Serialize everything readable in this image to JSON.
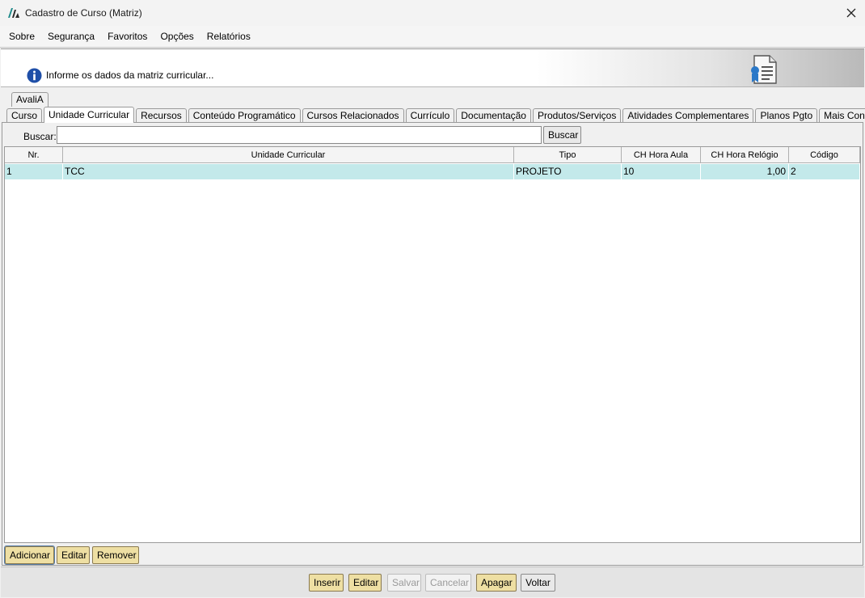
{
  "window": {
    "title": "Cadastro de Curso (Matriz)"
  },
  "menu": [
    {
      "label": "Sobre"
    },
    {
      "label": "Segurança"
    },
    {
      "label": "Favoritos"
    },
    {
      "label": "Opções"
    },
    {
      "label": "Relatórios"
    }
  ],
  "banner": {
    "message": "Informe os dados da matriz curricular..."
  },
  "tabs_top": [
    "AvaliA"
  ],
  "tabs": [
    "Curso",
    "Unidade Curricular",
    "Recursos",
    "Conteúdo Programático",
    "Cursos Relacionados",
    "Currículo",
    "Documentação",
    "Produtos/Serviços",
    "Atividades Complementares",
    "Planos Pgto",
    "Mais Configs."
  ],
  "active_tab": "Unidade Curricular",
  "search": {
    "label": "Buscar:",
    "value": "",
    "button": "Buscar"
  },
  "table": {
    "columns": [
      "Nr.",
      "Unidade Curricular",
      "Tipo",
      "CH Hora Aula",
      "CH Hora Relógio",
      "Código"
    ],
    "rows": [
      [
        "1",
        "TCC",
        "PROJETO",
        "10",
        "1,00",
        "2"
      ]
    ]
  },
  "panel_buttons": {
    "add": "Adicionar",
    "edit": "Editar",
    "remove": "Remover"
  },
  "footer_buttons": {
    "insert": "Inserir",
    "edit": "Editar",
    "save": "Salvar",
    "cancel": "Cancelar",
    "delete": "Apagar",
    "back": "Voltar"
  },
  "colors": {
    "row_selected": "#c3e9ea",
    "button_yellow": "#eedfa3",
    "info_blue": "#1f4fa8"
  }
}
